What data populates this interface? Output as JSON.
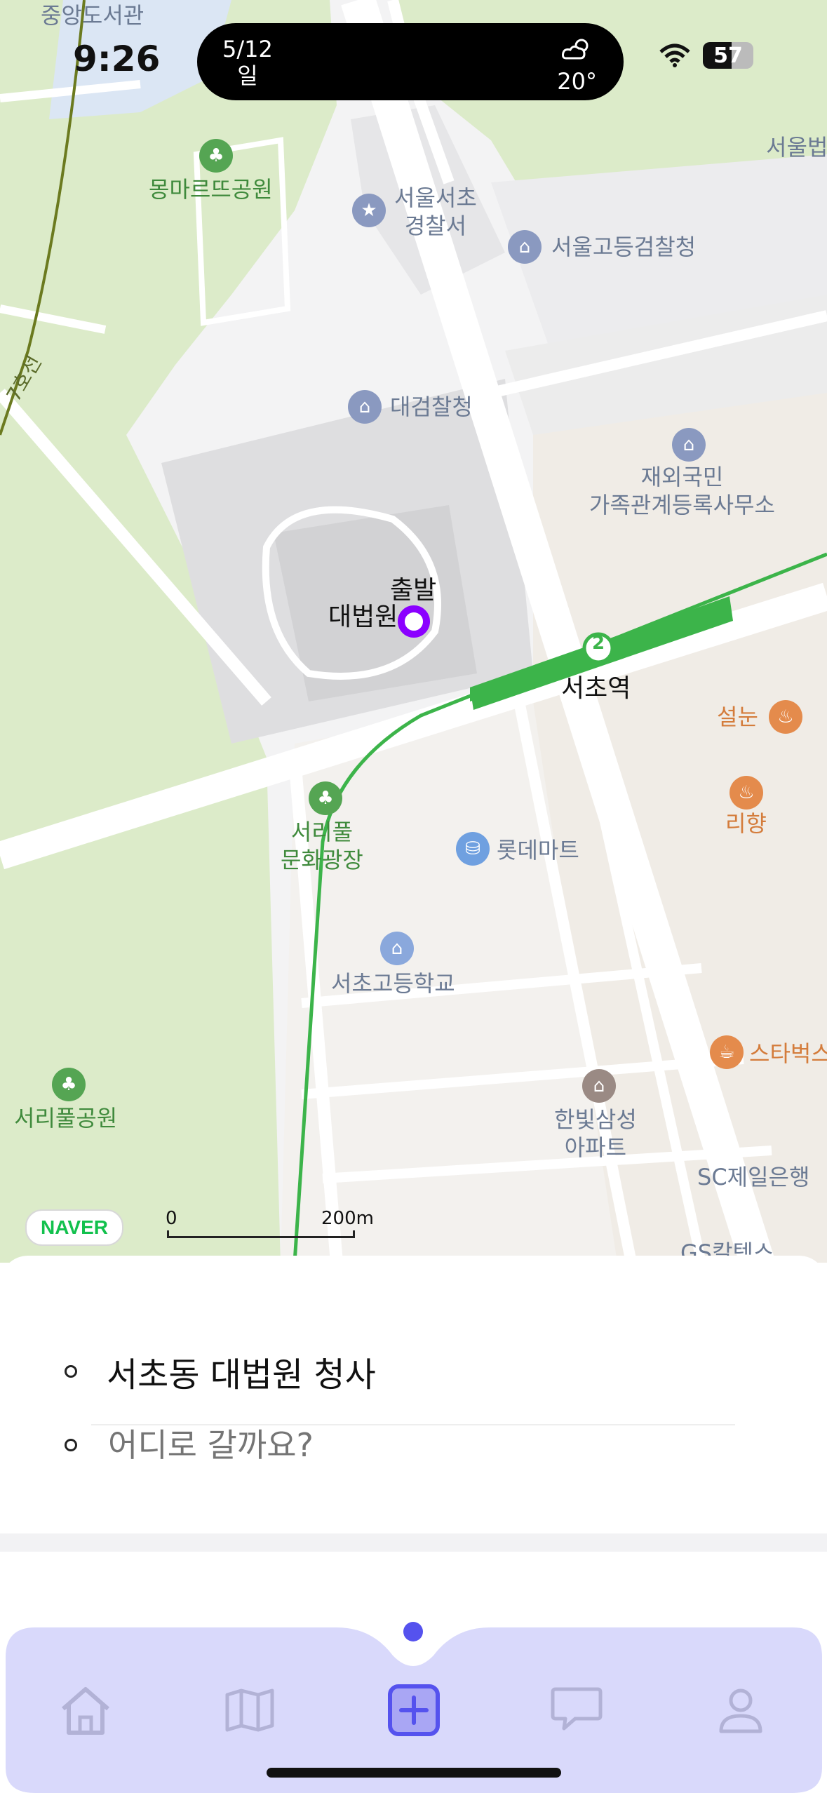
{
  "status_bar": {
    "time": "9:26",
    "date": "5/12",
    "weekday": "일",
    "temperature": "20°",
    "battery": "57"
  },
  "map": {
    "pois": {
      "jungang_library": "중앙도서관",
      "montmartre_park": "몽마르뜨공원",
      "police": "서울서초\n경찰서",
      "high_prosecutor": "서울고등검찰청",
      "supreme_prosecutor": "대검찰청",
      "overseas_office": "재외국민\n가족관계등록사무소",
      "start_label": "출발",
      "supreme_court": "대법원",
      "seocho_station": "서초역",
      "seolnun": "설눈",
      "rihyang": "리향",
      "seoripul_plaza": "서리풀\n문화광장",
      "lotte_mart": "롯데마트",
      "seocho_highschool": "서초고등학교",
      "starbucks": "스타벅스",
      "hanbit_apt": "한빛삼성\n아파트",
      "seoripul_park": "서리풀공원",
      "sc_bank": "SC제일은행",
      "gs_caltex": "GS칼텍스",
      "seoul_top_right": "서울법",
      "subway_line": "7호선",
      "line_number": "2"
    },
    "naver_logo": "NAVER",
    "scale_start": "0",
    "scale_end": "200m"
  },
  "route": {
    "from": "서초동 대법원 청사",
    "to_placeholder": "어디로 갈까요?"
  },
  "tabs": [
    {
      "name": "home-icon"
    },
    {
      "name": "map-icon"
    },
    {
      "name": "add-icon",
      "active": true
    },
    {
      "name": "chat-icon"
    },
    {
      "name": "profile-icon"
    }
  ],
  "colors": {
    "accent": "#5552ee",
    "tabbar_bg": "#d9d9fb",
    "subway_green": "#3cb44a",
    "origin_marker": "#8b00ff"
  }
}
